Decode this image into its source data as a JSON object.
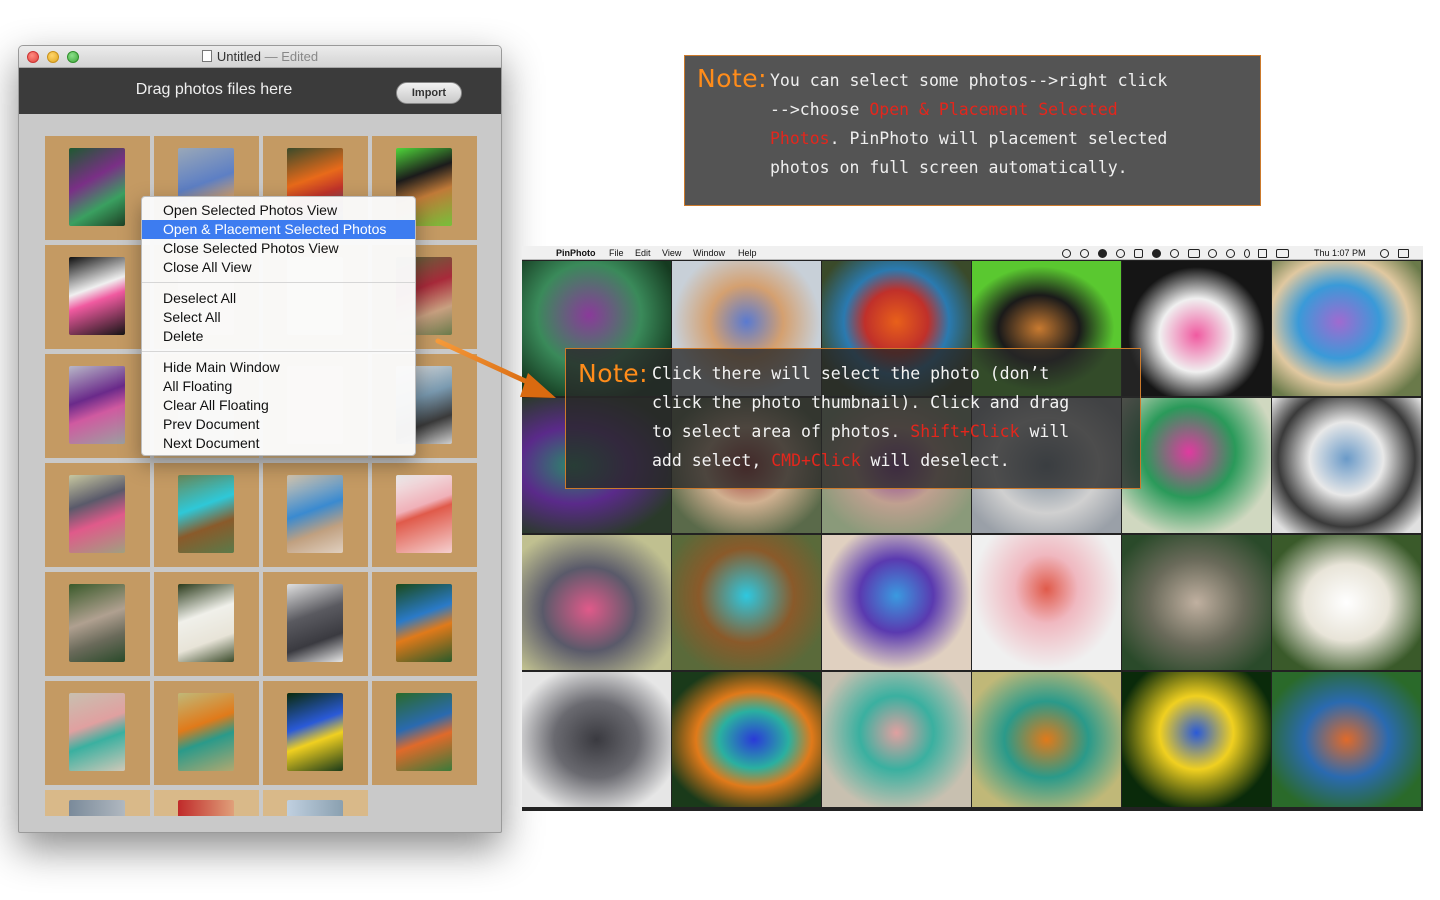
{
  "window": {
    "title": "Untitled",
    "title_suffix": "— Edited",
    "drag_label": "Drag photos files here",
    "import_label": "Import"
  },
  "context_menu": {
    "items": [
      {
        "label": "Open Selected Photos View"
      },
      {
        "label": "Open & Placement Selected Photos",
        "highlighted": true
      },
      {
        "label": "Close Selected Photos View"
      },
      {
        "label": "Close All View"
      },
      {
        "label": "Deselect All"
      },
      {
        "label": "Select All"
      },
      {
        "label": "Delete"
      },
      {
        "label": "Hide Main Window"
      },
      {
        "label": "All Floating"
      },
      {
        "label": "Clear All Floating"
      },
      {
        "label": "Prev Document"
      },
      {
        "label": "Next Document"
      }
    ]
  },
  "note1": {
    "head": "Note:",
    "l1": "You can select some photos-->right click",
    "l2a": "-->choose ",
    "l2b": "Open & Placement Selected",
    "l3a": "Photos",
    "l3b": ". PinPhoto will placement selected",
    "l4": "photos on full screen automatically."
  },
  "note2": {
    "head": "Note:",
    "l1": "Click there will select the photo (don’t",
    "l2": "click the photo thumbnail). Click and drag",
    "l3a": "to select area of photos. ",
    "l3b": "Shift+Click",
    "l3c": " will",
    "l4a": "add select, ",
    "l4b": "CMD+Click",
    "l4c": " will deselect."
  },
  "menubar": {
    "app": "PinPhoto",
    "items": [
      "File",
      "Edit",
      "View",
      "Window",
      "Help"
    ],
    "clock": "Thu 1:07 PM"
  },
  "colors": {
    "accent_orange": "#ff8c1a",
    "highlight_red": "#e3261c",
    "menu_selection": "#3d7cf0",
    "thumb_cell": "#c49a63"
  }
}
